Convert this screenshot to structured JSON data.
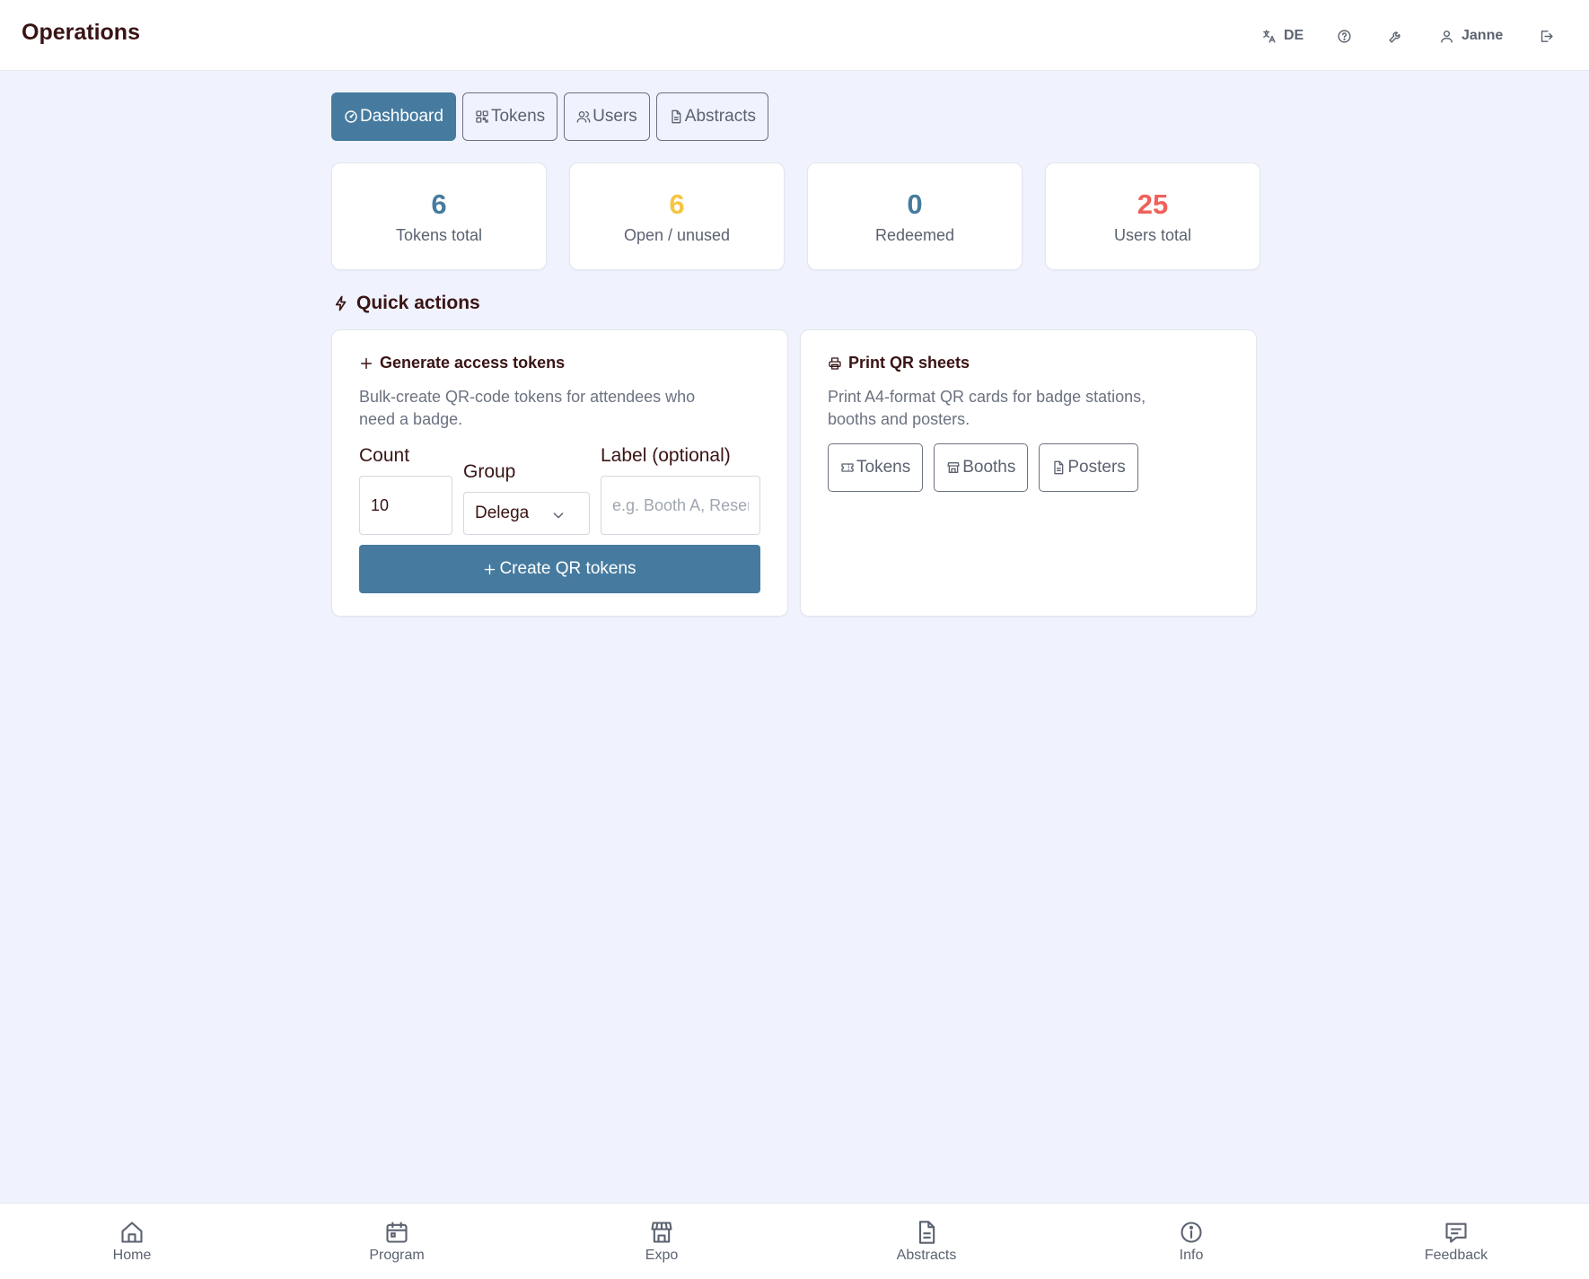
{
  "header": {
    "title": "Operations",
    "language_label": "DE",
    "user_name": "Janne"
  },
  "tabs": [
    {
      "label": "Dashboard",
      "icon": "gauge-icon",
      "active": true
    },
    {
      "label": "Tokens",
      "icon": "qr-icon",
      "active": false
    },
    {
      "label": "Users",
      "icon": "users-icon",
      "active": false
    },
    {
      "label": "Abstracts",
      "icon": "document-icon",
      "active": false
    }
  ],
  "stats": [
    {
      "value": "6",
      "label": "Tokens total",
      "color": "#467b9f"
    },
    {
      "value": "6",
      "label": "Open / unused",
      "color": "#f5c542"
    },
    {
      "value": "0",
      "label": "Redeemed",
      "color": "#467b9f"
    },
    {
      "value": "25",
      "label": "Users total",
      "color": "#f0605a"
    }
  ],
  "quick_actions": {
    "heading": "Quick actions",
    "generate": {
      "title": "Generate access tokens",
      "description_line1": "Bulk-create QR-code tokens for attendees who",
      "description_line2": "need a badge.",
      "count_label": "Count",
      "count_value": "10",
      "group_label": "Group",
      "group_value": "Delegate",
      "label_label": "Label (optional)",
      "label_placeholder": "e.g. Booth A, Reserve",
      "create_button": "Create QR tokens"
    },
    "print": {
      "title": "Print QR sheets",
      "description_line1": "Print A4-format QR cards for badge stations,",
      "description_line2": "booths and posters.",
      "buttons": [
        {
          "label": "Tokens",
          "icon": "ticket-icon"
        },
        {
          "label": "Booths",
          "icon": "store-icon"
        },
        {
          "label": "Posters",
          "icon": "document-icon"
        }
      ]
    }
  },
  "bottom_nav": [
    {
      "label": "Home",
      "icon": "home-icon"
    },
    {
      "label": "Program",
      "icon": "calendar-icon"
    },
    {
      "label": "Expo",
      "icon": "store-icon"
    },
    {
      "label": "Abstracts",
      "icon": "document-icon"
    },
    {
      "label": "Info",
      "icon": "info-icon"
    },
    {
      "label": "Feedback",
      "icon": "chat-icon"
    }
  ],
  "colors": {
    "accent": "#467b9f",
    "background": "#f0f3fd",
    "text_dark": "#3a1414",
    "text_muted": "#5b6270"
  }
}
